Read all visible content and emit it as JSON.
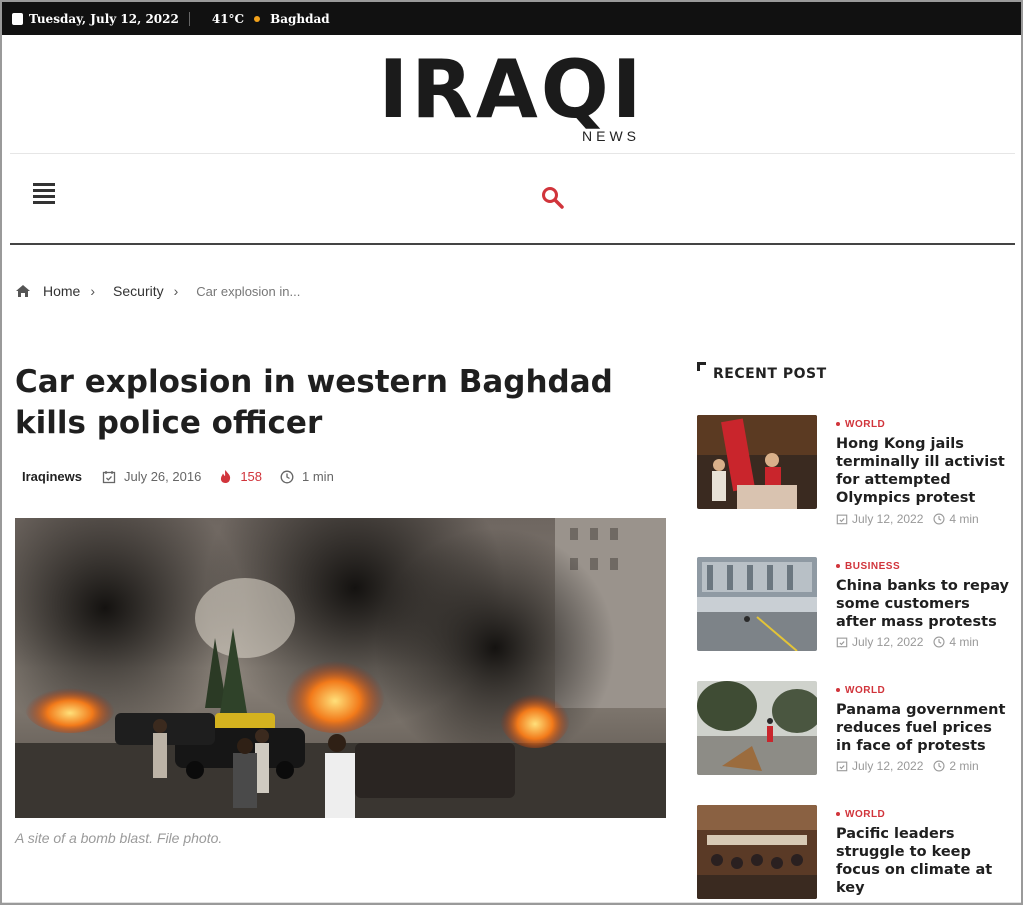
{
  "topbar": {
    "date": "Tuesday, July 12, 2022",
    "temperature": "41°C",
    "city": "Baghdad"
  },
  "logo": {
    "main": "IRAQI",
    "sub": "NEWS"
  },
  "nav": {
    "menu_icon": "hamburger-icon",
    "search_icon": "search-icon",
    "accent": "#d1343b"
  },
  "breadcrumb": {
    "items": [
      "Home",
      "Security"
    ],
    "current": "Car explosion in..."
  },
  "article": {
    "title": "Car explosion in western Baghdad kills police officer",
    "author": "Iraqinews",
    "date": "July 26, 2016",
    "views": "158",
    "read_time": "1 min",
    "caption": "A site of a bomb blast. File photo."
  },
  "recent": {
    "heading": "RECENT POST",
    "posts": [
      {
        "category": "WORLD",
        "title": "Hong Kong jails terminally ill activist for attempted Olympics protest",
        "date": "July 12, 2022",
        "read": "4 min"
      },
      {
        "category": "BUSINESS",
        "title": "China banks to repay some customers after mass protests",
        "date": "July 12, 2022",
        "read": "4 min"
      },
      {
        "category": "WORLD",
        "title": "Panama government reduces fuel prices in face of protests",
        "date": "July 12, 2022",
        "read": "2 min"
      },
      {
        "category": "WORLD",
        "title": "Pacific leaders struggle to keep focus on climate at key",
        "date": "",
        "read": ""
      }
    ]
  }
}
